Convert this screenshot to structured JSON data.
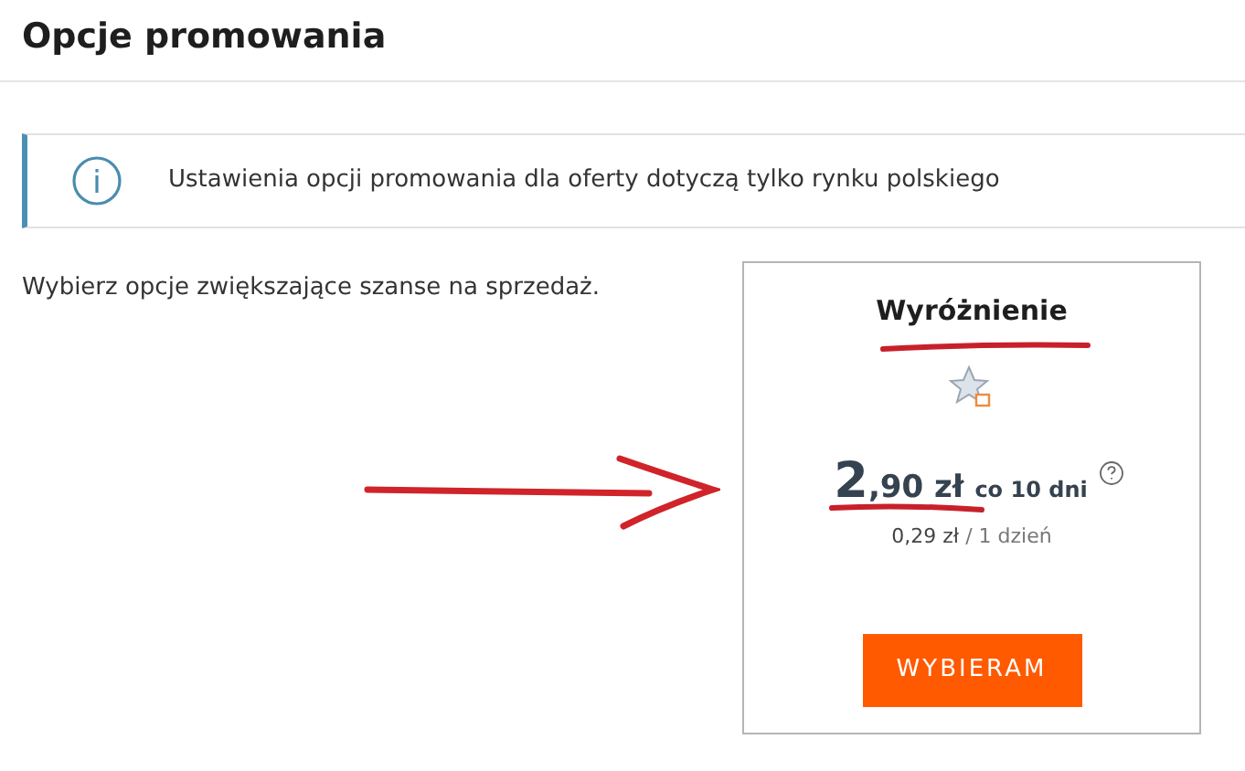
{
  "title": "Opcje promowania",
  "info": {
    "text": "Ustawienia opcji promowania dla oferty dotyczą tylko rynku polskiego"
  },
  "intro": "Wybierz opcje zwiększające szanse na sprzedaż.",
  "option": {
    "name": "Wyróżnienie",
    "price_integer": "2",
    "price_rest": ",90 zł",
    "period": "co 10 dni",
    "daily_price": "0,29 zł",
    "daily_unit": "/ 1 dzień",
    "button": "WYBIERAM"
  }
}
